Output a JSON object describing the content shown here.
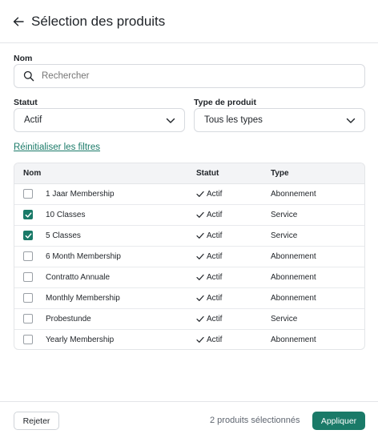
{
  "header": {
    "title": "Sélection des produits",
    "back_icon": "arrow-left-icon"
  },
  "search": {
    "label": "Nom",
    "placeholder": "Rechercher",
    "value": ""
  },
  "filters": {
    "status_label": "Statut",
    "status_value": "Actif",
    "type_label": "Type de produit",
    "type_value": "Tous les types"
  },
  "reset_label": "Réinitialiser les filtres",
  "table": {
    "headers": {
      "name": "Nom",
      "status": "Statut",
      "type": "Type"
    },
    "rows": [
      {
        "name": "1 Jaar Membership",
        "status": "Actif",
        "type": "Abonnement",
        "checked": false
      },
      {
        "name": "10 Classes",
        "status": "Actif",
        "type": "Service",
        "checked": true
      },
      {
        "name": "5 Classes",
        "status": "Actif",
        "type": "Service",
        "checked": true
      },
      {
        "name": "6 Month Membership",
        "status": "Actif",
        "type": "Abonnement",
        "checked": false
      },
      {
        "name": "Contratto Annuale",
        "status": "Actif",
        "type": "Abonnement",
        "checked": false
      },
      {
        "name": "Monthly Membership",
        "status": "Actif",
        "type": "Abonnement",
        "checked": false
      },
      {
        "name": "Probestunde",
        "status": "Actif",
        "type": "Service",
        "checked": false
      },
      {
        "name": "Yearly Membership",
        "status": "Actif",
        "type": "Abonnement",
        "checked": false
      }
    ]
  },
  "footer": {
    "reject_label": "Rejeter",
    "selected_count_text": "2 produits sélectionnés",
    "apply_label": "Appliquer"
  },
  "colors": {
    "accent": "#1a7a68",
    "border": "#e3e5e8",
    "header_bg": "#f3f4f6"
  }
}
